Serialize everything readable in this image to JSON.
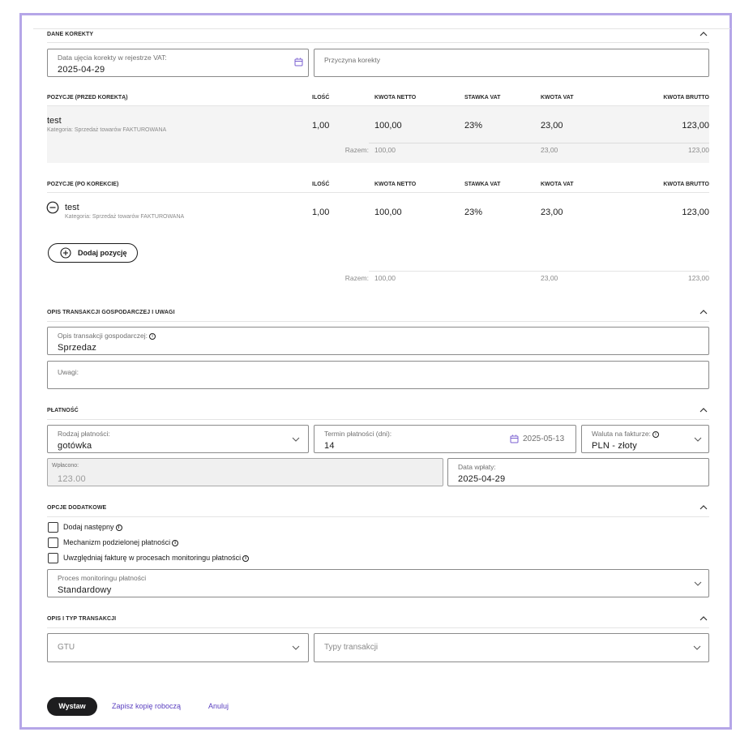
{
  "dane_korekty": {
    "title": "DANE KOREKTY",
    "date_label": "Data ujęcia korekty w rejestrze VAT:",
    "date_value": "2025-04-29",
    "reason_placeholder": "Przyczyna korekty"
  },
  "columns": {
    "ilosc": "ILOŚĆ",
    "netto": "KWOTA NETTO",
    "stawka": "STAWKA VAT",
    "vat": "KWOTA VAT",
    "brutto": "KWOTA BRUTTO"
  },
  "before": {
    "title": "POZYCJE (PRZED KOREKTĄ)",
    "row": {
      "name": "test",
      "category": "Kategoria: Sprzedaż towarów FAKTUROWANA",
      "ilosc": "1,00",
      "netto": "100,00",
      "stawka": "23%",
      "vat": "23,00",
      "brutto": "123,00"
    },
    "sum": {
      "label": "Razem:",
      "netto": "100,00",
      "vat": "23,00",
      "brutto": "123,00"
    }
  },
  "after": {
    "title": "POZYCJE (PO KOREKCIE)",
    "row": {
      "name": "test",
      "category": "Kategoria: Sprzedaż towarów FAKTUROWANA",
      "ilosc": "1,00",
      "netto": "100,00",
      "stawka": "23%",
      "vat": "23,00",
      "brutto": "123,00"
    },
    "add_button": "Dodaj pozycję",
    "sum": {
      "label": "Razem:",
      "netto": "100,00",
      "vat": "23,00",
      "brutto": "123,00"
    }
  },
  "opis": {
    "title": "OPIS TRANSAKCJI GOSPODARCZEJ I UWAGI",
    "desc_label": "Opis transakcji gospodarczej:",
    "desc_value": "Sprzedaz",
    "notes_label": "Uwagi:"
  },
  "platnosc": {
    "title": "PŁATNOŚĆ",
    "type_label": "Rodzaj płatności:",
    "type_value": "gotówka",
    "term_label": "Termin płatności (dni):",
    "term_value": "14",
    "term_date": "2025-05-13",
    "currency_label": "Waluta na fakturze:",
    "currency_value": "PLN - złoty",
    "paid_label": "Wpłacono:",
    "paid_value": "123.00",
    "paid_date_label": "Data wpłaty:",
    "paid_date_value": "2025-04-29"
  },
  "opcje": {
    "title": "OPCJE DODATKOWE",
    "checkbox1": "Dodaj następny",
    "checkbox2": "Mechanizm podzielonej płatności",
    "checkbox3": "Uwzględniaj fakturę w procesach monitoringu płatności",
    "process_label": "Proces monitoringu płatności",
    "process_value": "Standardowy"
  },
  "typ": {
    "title": "OPIS I TYP TRANSAKCJI",
    "gtu_placeholder": "GTU",
    "types_placeholder": "Typy transakcji"
  },
  "actions": {
    "issue": "Wystaw",
    "draft": "Zapisz kopię roboczą",
    "cancel": "Anuluj"
  },
  "colors": {
    "accent": "#b5a6e8",
    "link": "#5a3fc0",
    "dark_button": "#1d1d1f"
  }
}
